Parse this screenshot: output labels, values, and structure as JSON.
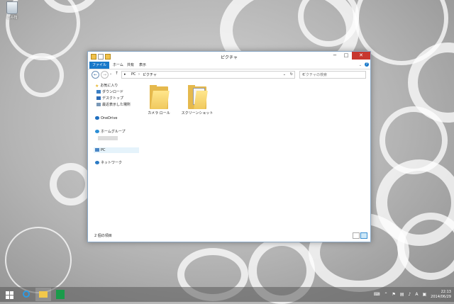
{
  "desktop": {
    "recycle_bin_label": "ごみ箱"
  },
  "window": {
    "title": "ピクチャ",
    "controls": {
      "minimize": "−",
      "maximize": "□",
      "close": "✕"
    },
    "ribbon": {
      "tabs": [
        "ファイル",
        "ホーム",
        "共有",
        "表示"
      ],
      "help": "?"
    },
    "address": {
      "segments": [
        "PC",
        "ピクチャ"
      ]
    },
    "search": {
      "placeholder": "ピクチャの検索"
    },
    "nav": {
      "items": [
        {
          "label": "お気に入り",
          "icon": "star-icon"
        },
        {
          "label": "ダウンロード",
          "icon": "download-icon"
        },
        {
          "label": "デスクトップ",
          "icon": "desktop-icon"
        },
        {
          "label": "最近表示した場所",
          "icon": "recent-places-icon"
        },
        {
          "label": "OneDrive",
          "icon": "cloud-icon"
        },
        {
          "label": "ホームグループ",
          "icon": "homegroup-icon"
        },
        {
          "label": "PC",
          "icon": "pc-icon"
        },
        {
          "label": "ネットワーク",
          "icon": "network-icon"
        }
      ]
    },
    "folders": [
      {
        "label": "カメラ ロール",
        "type": "plain"
      },
      {
        "label": "スクリーンショット",
        "type": "screenshots"
      }
    ],
    "status": {
      "item_count": "2 個の項目"
    }
  },
  "taskbar": {
    "clock_time": "22:13",
    "clock_date": "2014/06/29",
    "ime": "A"
  },
  "colors": {
    "accent": "#1979ca",
    "close": "#c7372f",
    "folder": "#e5b94d"
  }
}
